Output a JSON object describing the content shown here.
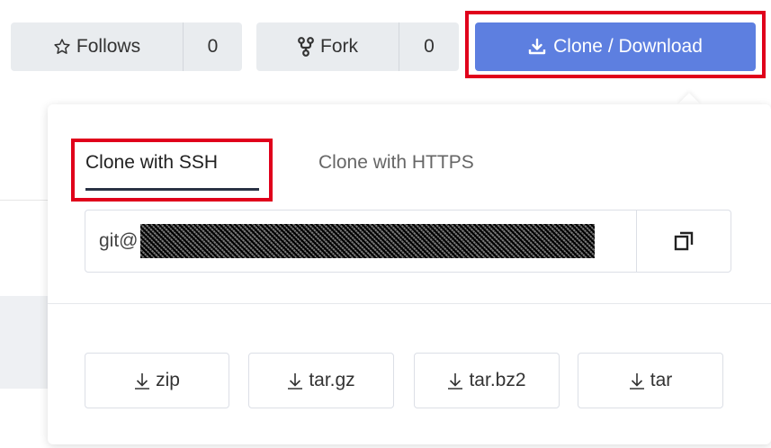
{
  "header": {
    "follows": {
      "label": "Follows",
      "count": "0",
      "icon": "star-outline-icon"
    },
    "fork": {
      "label": "Fork",
      "count": "0",
      "icon": "fork-icon"
    },
    "clone": {
      "label": "Clone / Download",
      "icon": "download-icon",
      "color": "#5d7fe0"
    }
  },
  "dropdown": {
    "tabs": [
      {
        "label": "Clone with SSH",
        "active": true
      },
      {
        "label": "Clone with HTTPS",
        "active": false
      }
    ],
    "url_prefix": "git@",
    "copy_icon": "copy-icon",
    "downloads": [
      {
        "label": "zip"
      },
      {
        "label": "tar.gz"
      },
      {
        "label": "tar.bz2"
      },
      {
        "label": "tar"
      }
    ]
  },
  "colors": {
    "highlight": "#e0001b",
    "accent": "#5d7fe0",
    "tab_underline": "#2a3245"
  }
}
